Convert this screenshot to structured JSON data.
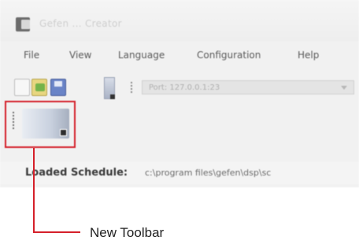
{
  "window": {
    "title": "Gefen ... Creator"
  },
  "menu": {
    "items": [
      "File",
      "View",
      "Language",
      "Configuration",
      "Help"
    ]
  },
  "toolbar": {
    "combo_value": "Port: 127.0.0.1:23"
  },
  "status": {
    "label": "Loaded Schedule:",
    "value": "c:\\program files\\gefen\\dsp\\sc"
  },
  "annotation": {
    "label": "New Toolbar",
    "color": "#d5202a"
  }
}
